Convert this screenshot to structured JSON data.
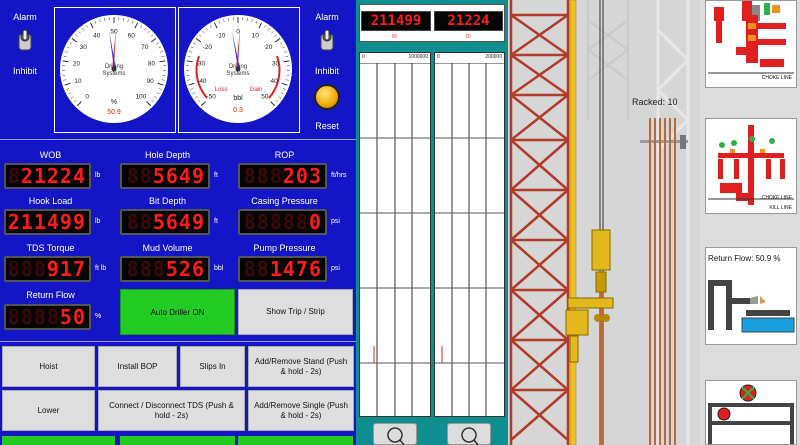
{
  "left": {
    "alarm_left": "Alarm",
    "inhibit_left": "Inhibit",
    "alarm_right": "Alarm",
    "inhibit_right": "Inhibit",
    "reset": "Reset",
    "gauge1": {
      "label_line1": "Drilling",
      "label_line2": "Systems",
      "unit": "%",
      "value": "50.9",
      "ticks": [
        "0",
        "10",
        "20",
        "30",
        "40",
        "50",
        "60",
        "70",
        "80",
        "90",
        "100"
      ]
    },
    "gauge2": {
      "label_line1": "Drilling",
      "label_line2": "Systems",
      "unit": "bbl",
      "value": "0.3",
      "loss": "Loss",
      "gain": "Gain",
      "ticks": [
        "-50",
        "-40",
        "-30",
        "-20",
        "-10",
        "0",
        "10",
        "20",
        "30",
        "40",
        "50"
      ]
    },
    "readouts": [
      {
        "label": "WOB",
        "value": "21224",
        "unit": "lb"
      },
      {
        "label": "Hole Depth",
        "value": "5649",
        "unit": "ft"
      },
      {
        "label": "ROP",
        "value": "203",
        "unit": "ft/hrs"
      },
      {
        "label": "Hook Load",
        "value": "211499",
        "unit": "lb"
      },
      {
        "label": "Bit Depth",
        "value": "5649",
        "unit": "ft"
      },
      {
        "label": "Casing Pressure",
        "value": "0",
        "unit": "psi"
      },
      {
        "label": "TDS Torque",
        "value": "917",
        "unit": "ft lb"
      },
      {
        "label": "Mud Volume",
        "value": "526",
        "unit": "bbl"
      },
      {
        "label": "Pump Pressure",
        "value": "1476",
        "unit": "psi"
      },
      {
        "label": "Return Flow",
        "value": "50",
        "unit": "%"
      }
    ],
    "auto_driller": "Auto Driller ON",
    "show_trip": "Show Trip / Strip",
    "buttons": {
      "hoist": "Hoist",
      "install_bop": "Install BOP",
      "slips_in": "Slips In",
      "add_stand": "Add/Remove Stand (Push & hold - 2s)",
      "lower": "Lower",
      "connect_tds": "Connect / Disconnect TDS (Push & hold - 2s)",
      "add_single": "Add/Remove Single (Push & hold - 2s)"
    }
  },
  "middle": {
    "lcd1": "211499",
    "lcd2": "21224",
    "unit1": "lb",
    "unit2": "lb",
    "scale1": {
      "min": "0",
      "max": "1000000"
    },
    "scale2": {
      "min": "0",
      "max": "200000"
    }
  },
  "rig": {
    "racked_label": "Racked:",
    "racked_value": "10"
  },
  "right": {
    "choke_line_1": "CHOKE LINE",
    "choke_line_2": "CHOKE LINE",
    "kill_line": "KILL LINE",
    "return_flow_label": "Return Flow:",
    "return_flow_value": "50.9 %"
  },
  "colors": {
    "panel_blue": "#1515c8",
    "lcd_red": "#ff1a1a",
    "teal": "#0e8e8e",
    "green": "#22cc22"
  }
}
